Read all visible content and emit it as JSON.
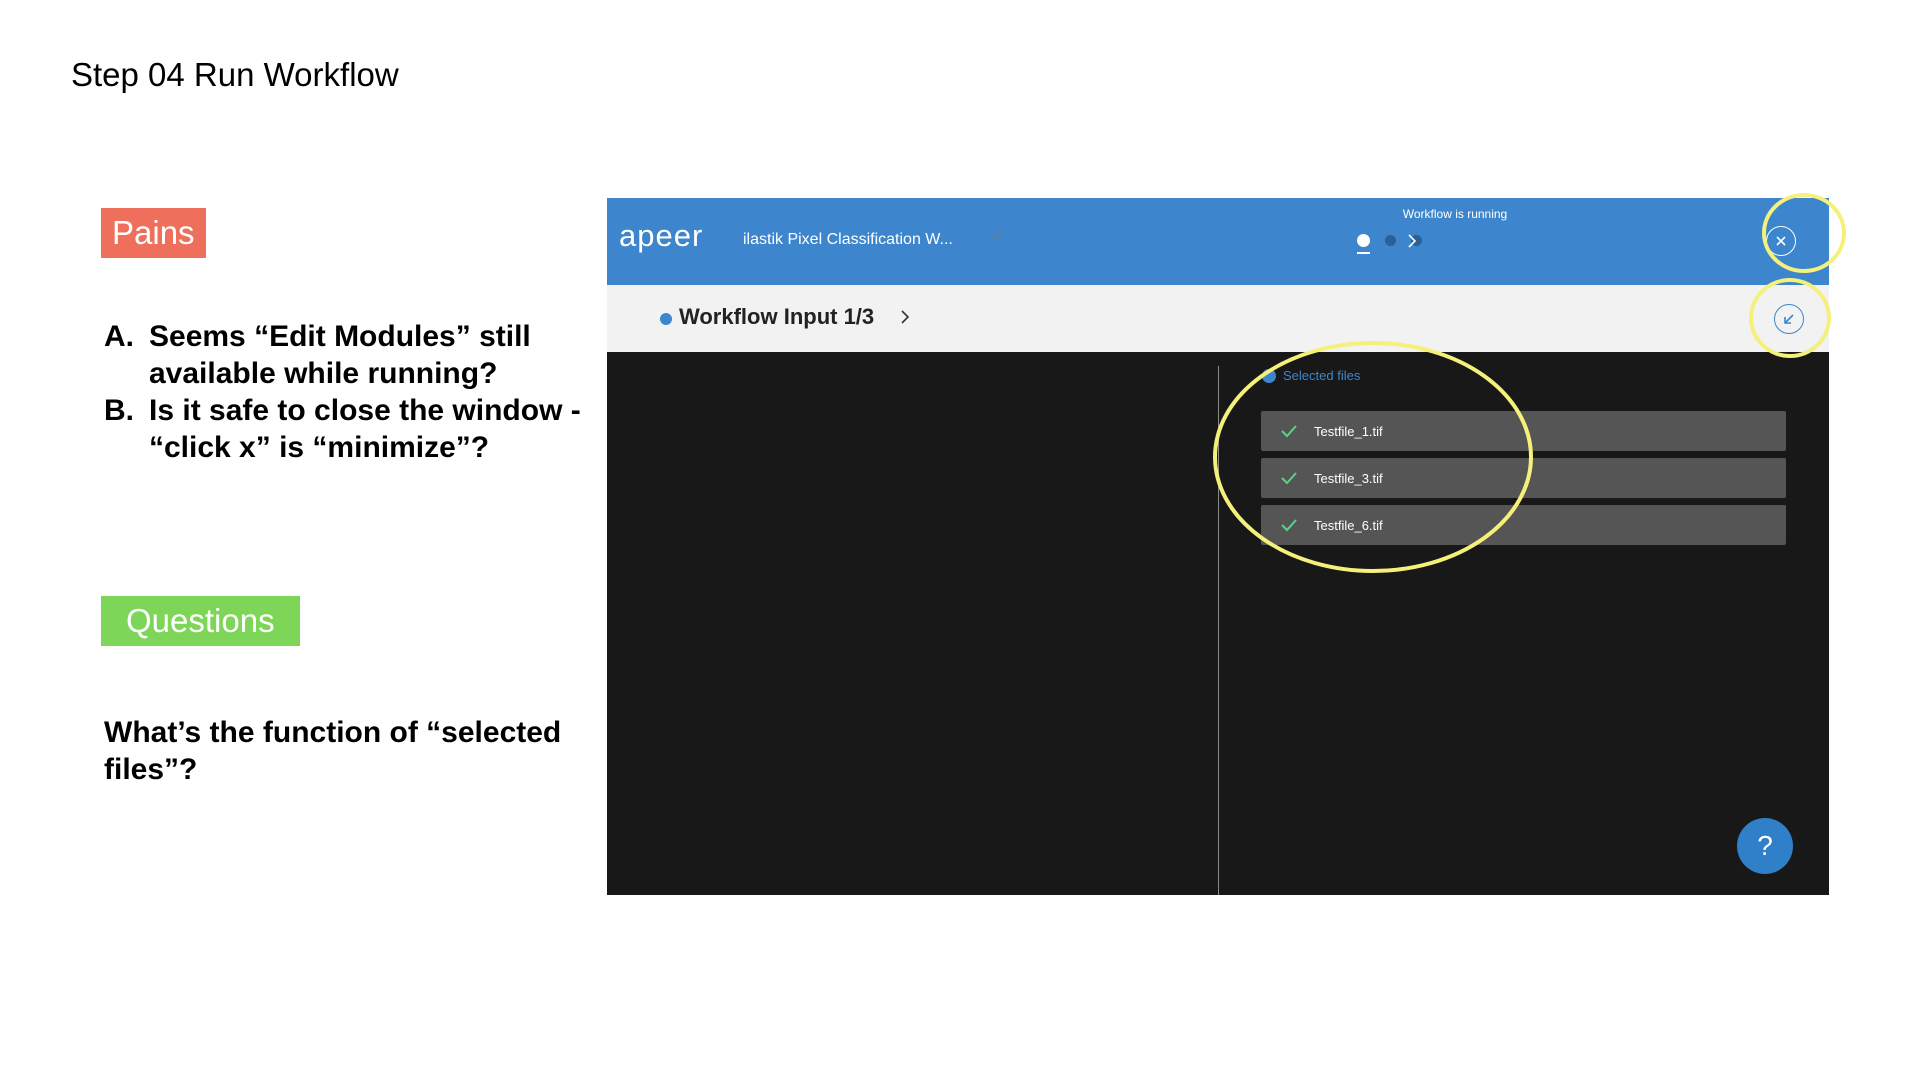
{
  "slide": {
    "title": "Step 04 Run Workflow",
    "pains_label": "Pains",
    "pains": [
      {
        "letter": "A.",
        "text": "Seems “Edit Modules” still available while running?"
      },
      {
        "letter": "B.",
        "text": "Is it safe to close the window - “click x” is “minimize”?"
      }
    ],
    "questions_label": "Questions",
    "question": "What’s the function of “selected files”?"
  },
  "app": {
    "logo": "apeer",
    "workflow_name": "ilastik Pixel Classification W...",
    "status": "Workflow is running",
    "step_title": "Workflow Input 1/3",
    "selected_files_label": "Selected files",
    "files": [
      "Testfile_1.tif",
      "Testfile_3.tif",
      "Testfile_6.tif"
    ],
    "help": "?"
  },
  "colors": {
    "pains": "#ee6f5b",
    "questions": "#7ed658",
    "header": "#3d86cd",
    "highlight": "#f4f07a",
    "check": "#5bd08a"
  },
  "icons": [
    "edit-icon",
    "chevron-right-icon",
    "close-icon",
    "minimize-icon",
    "check-icon",
    "help-icon"
  ]
}
